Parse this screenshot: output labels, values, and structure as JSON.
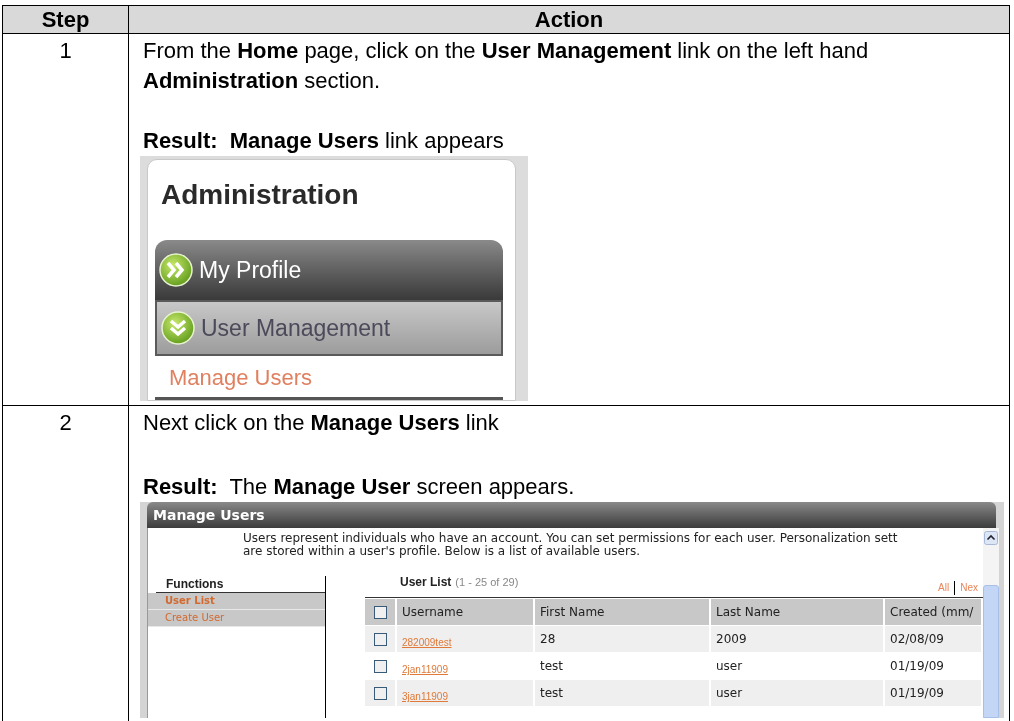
{
  "table": {
    "columns": [
      "Step",
      "Action"
    ],
    "rows": [
      {
        "step": "1",
        "instruction": "From the **Home** page, click on the **User Management** link on the left hand **Administration** section.",
        "result": "**Result:  Manage Users** link appears",
        "screenshot": {
          "kind": "admin_menu",
          "heading": "Administration",
          "items": [
            {
              "label": "My Profile",
              "expanded": false
            },
            {
              "label": "User Management",
              "expanded": true
            }
          ],
          "sub_link": "Manage Users"
        }
      },
      {
        "step": "2",
        "instruction": "Next click on the **Manage Users** link",
        "result": "**Result:**  The **Manage User** screen appears.",
        "screenshot": {
          "kind": "manage_users",
          "title": "Manage Users",
          "description": "Users represent individuals who have an account. You can set permissions for each user. Personalization sett\nare stored within a user's profile. Below is a list of available users.",
          "functions": {
            "heading": "Functions",
            "items": [
              {
                "label": "User List",
                "selected": true
              },
              {
                "label": "Create User",
                "selected": false
              }
            ]
          },
          "user_list": {
            "heading": "User List",
            "count": "(1 - 25 of 29)",
            "links": [
              "All",
              "Nex"
            ],
            "select_all_checked": false,
            "columns": [
              "Username",
              "First Name",
              "Last Name",
              "Created (mm/"
            ],
            "rows": [
              {
                "checked": false,
                "cells": [
                  "282009test",
                  "28",
                  "2009",
                  "02/08/09"
                ]
              },
              {
                "checked": false,
                "cells": [
                  "2jan11909",
                  "test",
                  "user",
                  "01/19/09"
                ]
              },
              {
                "checked": false,
                "cells": [
                  "3jan11909",
                  "test",
                  "user",
                  "01/19/09"
                ]
              }
            ]
          }
        }
      }
    ]
  }
}
